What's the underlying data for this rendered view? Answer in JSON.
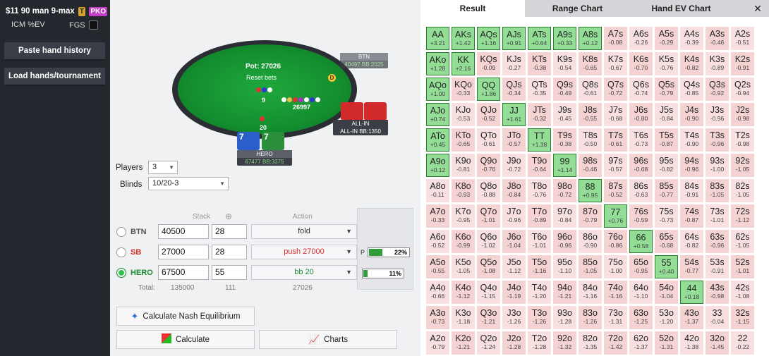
{
  "left": {
    "tournament": "$11 90 man 9-max",
    "badge_t": "T",
    "badge_pko": "PKO",
    "icm_label": "ICM %EV",
    "fgs_label": "FGS",
    "paste_btn": "Paste hand history",
    "load_btn": "Load hands/tournament"
  },
  "table": {
    "pot": "Pot: 27026",
    "reset": "Reset bets",
    "dealer": "D",
    "stack_mid": "26997",
    "stack_9": "9",
    "stack_20": "20",
    "btn_name": "BTN",
    "btn_stack": "40497 BB:2025",
    "sb_name": "ALL-IN",
    "sb_stack": "ALL-IN BB:1350",
    "hero_name": "HERO",
    "hero_stack": "67477 BB:3375",
    "hero_card1": "7",
    "hero_card2": "7"
  },
  "settings": {
    "players_label": "Players",
    "players_value": "3",
    "blinds_label": "Blinds",
    "blinds_value": "10/20-3"
  },
  "seats": {
    "hdr_stack": "Stack",
    "hdr_action": "Action",
    "rows": [
      {
        "pos": "BTN",
        "stack": "40500",
        "bb": "28",
        "action": "fold",
        "color": "#555555",
        "action_color": "#333333",
        "selected": false
      },
      {
        "pos": "SB",
        "stack": "27000",
        "bb": "28",
        "action": "push 27000",
        "color": "#d92b2b",
        "action_color": "#d92b2b",
        "selected": false
      },
      {
        "pos": "HERO",
        "stack": "67500",
        "bb": "55",
        "action": "bb 20",
        "color": "#1a8a2f",
        "action_color": "#1a8a2f",
        "selected": true
      }
    ],
    "total_label": "Total:",
    "total_stack": "135000",
    "total_bb": "111",
    "total_pot": "27026"
  },
  "range_bars": {
    "p_label": "P",
    "p_value": "22%",
    "p_fill": 0.22,
    "h_value": "11%",
    "h_fill": 0.11
  },
  "buttons": {
    "nash": "Calculate Nash Equilibrium",
    "calc": "Calculate",
    "charts": "Charts"
  },
  "tabs": {
    "result": "Result",
    "range": "Range Chart",
    "handev": "Hand EV Chart"
  },
  "colors": {
    "green_cell": "#93dd96",
    "pink_cell": "#f6d3d3"
  },
  "grid": [
    [
      [
        "AA",
        "+3.21",
        1
      ],
      [
        "AKs",
        "+1.42",
        1
      ],
      [
        "AQs",
        "+1.16",
        1
      ],
      [
        "AJs",
        "+0.91",
        1
      ],
      [
        "ATs",
        "+0.64",
        1
      ],
      [
        "A9s",
        "+0.33",
        1
      ],
      [
        "A8s",
        "+0.12",
        1
      ],
      [
        "A7s",
        "-0.08",
        0
      ],
      [
        "A6s",
        "-0.26",
        0
      ],
      [
        "A5s",
        "-0.29",
        0
      ],
      [
        "A4s",
        "-0.39",
        0
      ],
      [
        "A3s",
        "-0.46",
        0
      ],
      [
        "A2s",
        "-0.51",
        0
      ]
    ],
    [
      [
        "AKo",
        "+1.28",
        1
      ],
      [
        "KK",
        "+2.16",
        1
      ],
      [
        "KQs",
        "-0.09",
        0
      ],
      [
        "KJs",
        "-0.27",
        0
      ],
      [
        "KTs",
        "-0.38",
        0
      ],
      [
        "K9s",
        "-0.54",
        0
      ],
      [
        "K8s",
        "-0.65",
        0
      ],
      [
        "K7s",
        "-0.67",
        0
      ],
      [
        "K6s",
        "-0.70",
        0
      ],
      [
        "K5s",
        "-0.76",
        0
      ],
      [
        "K4s",
        "-0.82",
        0
      ],
      [
        "K3s",
        "-0.89",
        0
      ],
      [
        "K2s",
        "-0.91",
        0
      ]
    ],
    [
      [
        "AQo",
        "+1.00",
        1
      ],
      [
        "KQo",
        "-0.33",
        0
      ],
      [
        "QQ",
        "+1.86",
        1
      ],
      [
        "QJs",
        "-0.34",
        0
      ],
      [
        "QTs",
        "-0.35",
        0
      ],
      [
        "Q9s",
        "-0.49",
        0
      ],
      [
        "Q8s",
        "-0.61",
        0
      ],
      [
        "Q7s",
        "-0.72",
        0
      ],
      [
        "Q6s",
        "-0.74",
        0
      ],
      [
        "Q5s",
        "-0.79",
        0
      ],
      [
        "Q4s",
        "-0.85",
        0
      ],
      [
        "Q3s",
        "-0.92",
        0
      ],
      [
        "Q2s",
        "-0.94",
        0
      ]
    ],
    [
      [
        "AJo",
        "+0.74",
        1
      ],
      [
        "KJo",
        "-0.53",
        0
      ],
      [
        "QJo",
        "-0.52",
        0
      ],
      [
        "JJ",
        "+1.61",
        1
      ],
      [
        "JTs",
        "-0.32",
        0
      ],
      [
        "J9s",
        "-0.45",
        0
      ],
      [
        "J8s",
        "-0.55",
        0
      ],
      [
        "J7s",
        "-0.68",
        0
      ],
      [
        "J6s",
        "-0.80",
        0
      ],
      [
        "J5s",
        "-0.84",
        0
      ],
      [
        "J4s",
        "-0.90",
        0
      ],
      [
        "J3s",
        "-0.96",
        0
      ],
      [
        "J2s",
        "-0.98",
        0
      ]
    ],
    [
      [
        "ATo",
        "+0.45",
        1
      ],
      [
        "KTo",
        "-0.65",
        0
      ],
      [
        "QTo",
        "-0.61",
        0
      ],
      [
        "JTo",
        "-0.57",
        0
      ],
      [
        "TT",
        "+1.38",
        1
      ],
      [
        "T9s",
        "-0.38",
        0
      ],
      [
        "T8s",
        "-0.50",
        0
      ],
      [
        "T7s",
        "-0.61",
        0
      ],
      [
        "T6s",
        "-0.73",
        0
      ],
      [
        "T5s",
        "-0.87",
        0
      ],
      [
        "T4s",
        "-0.90",
        0
      ],
      [
        "T3s",
        "-0.96",
        0
      ],
      [
        "T2s",
        "-0.98",
        0
      ]
    ],
    [
      [
        "A9o",
        "+0.12",
        1
      ],
      [
        "K9o",
        "-0.81",
        0
      ],
      [
        "Q9o",
        "-0.76",
        0
      ],
      [
        "J9o",
        "-0.72",
        0
      ],
      [
        "T9o",
        "-0.64",
        0
      ],
      [
        "99",
        "+1.14",
        1
      ],
      [
        "98s",
        "-0.46",
        0
      ],
      [
        "97s",
        "-0.57",
        0
      ],
      [
        "96s",
        "-0.68",
        0
      ],
      [
        "95s",
        "-0.82",
        0
      ],
      [
        "94s",
        "-0.96",
        0
      ],
      [
        "93s",
        "-1.00",
        0
      ],
      [
        "92s",
        "-1.05",
        0
      ]
    ],
    [
      [
        "A8o",
        "-0.11",
        0
      ],
      [
        "K8o",
        "-0.93",
        0
      ],
      [
        "Q8o",
        "-0.88",
        0
      ],
      [
        "J8o",
        "-0.84",
        0
      ],
      [
        "T8o",
        "-0.76",
        0
      ],
      [
        "98o",
        "-0.72",
        0
      ],
      [
        "88",
        "+0.95",
        1
      ],
      [
        "87s",
        "-0.52",
        0
      ],
      [
        "86s",
        "-0.63",
        0
      ],
      [
        "85s",
        "-0.77",
        0
      ],
      [
        "84s",
        "-0.91",
        0
      ],
      [
        "83s",
        "-1.05",
        0
      ],
      [
        "82s",
        "-1.05",
        0
      ]
    ],
    [
      [
        "A7o",
        "-0.33",
        0
      ],
      [
        "K7o",
        "-0.95",
        0
      ],
      [
        "Q7o",
        "-1.01",
        0
      ],
      [
        "J7o",
        "-0.96",
        0
      ],
      [
        "T7o",
        "-0.89",
        0
      ],
      [
        "97o",
        "-0.84",
        0
      ],
      [
        "87o",
        "-0.79",
        0
      ],
      [
        "77",
        "+0.76",
        1
      ],
      [
        "76s",
        "-0.59",
        0
      ],
      [
        "75s",
        "-0.73",
        0
      ],
      [
        "74s",
        "-0.87",
        0
      ],
      [
        "73s",
        "-1.01",
        0
      ],
      [
        "72s",
        "-1.12",
        0
      ]
    ],
    [
      [
        "A6o",
        "-0.52",
        0
      ],
      [
        "K6o",
        "-0.99",
        0
      ],
      [
        "Q6o",
        "-1.02",
        0
      ],
      [
        "J6o",
        "-1.04",
        0
      ],
      [
        "T6o",
        "-1.01",
        0
      ],
      [
        "96o",
        "-0.96",
        0
      ],
      [
        "86o",
        "-0.90",
        0
      ],
      [
        "76o",
        "-0.86",
        0
      ],
      [
        "66",
        "+0.58",
        1
      ],
      [
        "65s",
        "-0.68",
        0
      ],
      [
        "64s",
        "-0.82",
        0
      ],
      [
        "63s",
        "-0.96",
        0
      ],
      [
        "62s",
        "-1.05",
        0
      ]
    ],
    [
      [
        "A5o",
        "-0.55",
        0
      ],
      [
        "K5o",
        "-1.05",
        0
      ],
      [
        "Q5o",
        "-1.08",
        0
      ],
      [
        "J5o",
        "-1.12",
        0
      ],
      [
        "T5o",
        "-1.16",
        0
      ],
      [
        "95o",
        "-1.10",
        0
      ],
      [
        "85o",
        "-1.05",
        0
      ],
      [
        "75o",
        "-1.00",
        0
      ],
      [
        "65o",
        "-0.95",
        0
      ],
      [
        "55",
        "+0.40",
        1
      ],
      [
        "54s",
        "-0.77",
        0
      ],
      [
        "53s",
        "-0.91",
        0
      ],
      [
        "52s",
        "-1.01",
        0
      ]
    ],
    [
      [
        "A4o",
        "-0.66",
        0
      ],
      [
        "K4o",
        "-1.12",
        0
      ],
      [
        "Q4o",
        "-1.15",
        0
      ],
      [
        "J4o",
        "-1.19",
        0
      ],
      [
        "T4o",
        "-1.20",
        0
      ],
      [
        "94o",
        "-1.21",
        0
      ],
      [
        "84o",
        "-1.16",
        0
      ],
      [
        "74o",
        "-1.16",
        0
      ],
      [
        "64o",
        "-1.10",
        0
      ],
      [
        "54o",
        "-1.04",
        0
      ],
      [
        "44",
        "+0.18",
        1
      ],
      [
        "43s",
        "-0.98",
        0
      ],
      [
        "42s",
        "-1.08",
        0
      ]
    ],
    [
      [
        "A3o",
        "-0.73",
        0
      ],
      [
        "K3o",
        "-1.18",
        0
      ],
      [
        "Q3o",
        "-1.21",
        0
      ],
      [
        "J3o",
        "-1.26",
        0
      ],
      [
        "T3o",
        "-1.26",
        0
      ],
      [
        "93o",
        "-1.28",
        0
      ],
      [
        "83o",
        "-1.26",
        0
      ],
      [
        "73o",
        "-1.31",
        0
      ],
      [
        "63o",
        "-1.25",
        0
      ],
      [
        "53o",
        "-1.20",
        0
      ],
      [
        "43o",
        "-1.37",
        0
      ],
      [
        "33",
        "-0.04",
        0
      ],
      [
        "32s",
        "-1.15",
        0
      ]
    ],
    [
      [
        "A2o",
        "-0.79",
        0
      ],
      [
        "K2o",
        "-1.21",
        0
      ],
      [
        "Q2o",
        "-1.24",
        0
      ],
      [
        "J2o",
        "-1.28",
        0
      ],
      [
        "T2o",
        "-1.28",
        0
      ],
      [
        "92o",
        "-1.32",
        0
      ],
      [
        "82o",
        "-1.35",
        0
      ],
      [
        "72o",
        "-1.42",
        0
      ],
      [
        "62o",
        "-1.37",
        0
      ],
      [
        "52o",
        "-1.31",
        0
      ],
      [
        "42o",
        "-1.38",
        0
      ],
      [
        "32o",
        "-1.45",
        0
      ],
      [
        "22",
        "-0.22",
        0
      ]
    ]
  ]
}
